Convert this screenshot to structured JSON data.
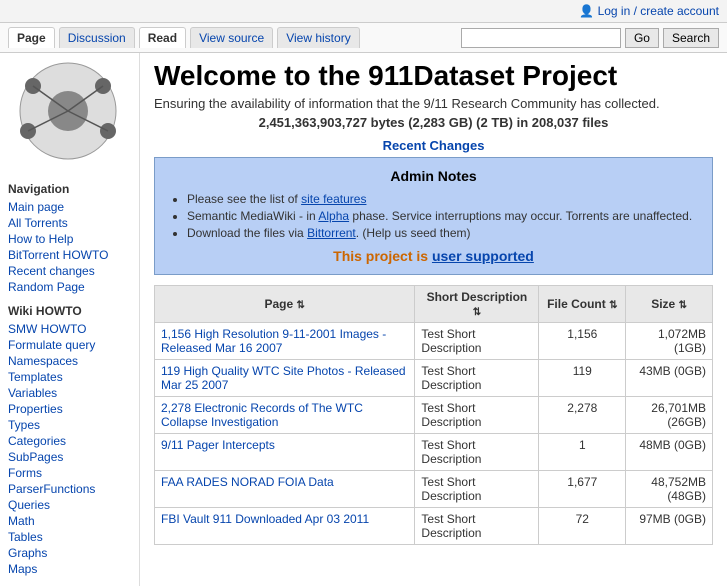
{
  "topbar": {
    "login_label": "Log in / create account",
    "icon": "👤"
  },
  "tabs": {
    "page": "Page",
    "discussion": "Discussion",
    "read": "Read",
    "view_source": "View source",
    "view_history": "View history",
    "search_placeholder": "",
    "go_label": "Go",
    "search_label": "Search"
  },
  "sidebar": {
    "nav_title": "Navigation",
    "nav_links": [
      {
        "label": "Main page",
        "href": "#"
      },
      {
        "label": "All Torrents",
        "href": "#"
      },
      {
        "label": "How to Help",
        "href": "#"
      },
      {
        "label": "BitTorrent HOWTO",
        "href": "#"
      },
      {
        "label": "Recent changes",
        "href": "#"
      },
      {
        "label": "Random Page",
        "href": "#"
      }
    ],
    "wiki_title": "Wiki HOWTO",
    "wiki_links": [
      {
        "label": "SMW HOWTO",
        "href": "#"
      },
      {
        "label": "Formulate query",
        "href": "#"
      },
      {
        "label": "Namespaces",
        "href": "#"
      },
      {
        "label": "Templates",
        "href": "#"
      },
      {
        "label": "Variables",
        "href": "#"
      },
      {
        "label": "Properties",
        "href": "#"
      },
      {
        "label": "Types",
        "href": "#"
      },
      {
        "label": "Categories",
        "href": "#"
      },
      {
        "label": "SubPages",
        "href": "#"
      },
      {
        "label": "Forms",
        "href": "#"
      },
      {
        "label": "ParserFunctions",
        "href": "#"
      },
      {
        "label": "Queries",
        "href": "#"
      },
      {
        "label": "Math",
        "href": "#"
      },
      {
        "label": "Tables",
        "href": "#"
      },
      {
        "label": "Graphs",
        "href": "#"
      },
      {
        "label": "Maps",
        "href": "#"
      }
    ]
  },
  "main": {
    "title": "Welcome to the 911Dataset Project",
    "subtitle": "Ensuring the availability of information that the 9/11 Research Community has collected.",
    "stats": "2,451,363,903,727 bytes (2,283 GB) (2 TB) in 208,037 files",
    "recent_changes": "Recent Changes",
    "admin_notes_title": "Admin Notes",
    "admin_notes": [
      {
        "text": "Please see the list of ",
        "link": "site features",
        "rest": ""
      },
      {
        "text": "Semantic MediaWiki - in ",
        "link": "Alpha",
        "rest": " phase. Service interruptions may occur. Torrents are unaffected."
      },
      {
        "text": "Download the files via ",
        "link": "Bittorrent",
        "rest": ". (Help us seed them)"
      }
    ],
    "supported_text": "This project is ",
    "supported_link": "user supported",
    "table": {
      "headers": [
        "Page",
        "Short Description",
        "File Count",
        "Size"
      ],
      "rows": [
        {
          "page": "1,156 High Resolution 9-11-2001 Images - Released Mar 16 2007",
          "desc": "Test Short Description",
          "count": "1,156",
          "size": "1,072MB (1GB)"
        },
        {
          "page": "119 High Quality WTC Site Photos - Released Mar 25 2007",
          "desc": "Test Short Description",
          "count": "119",
          "size": "43MB (0GB)"
        },
        {
          "page": "2,278 Electronic Records of The WTC Collapse Investigation",
          "desc": "Test Short Description",
          "count": "2,278",
          "size": "26,701MB (26GB)"
        },
        {
          "page": "9/11 Pager Intercepts",
          "desc": "Test Short Description",
          "count": "1",
          "size": "48MB (0GB)"
        },
        {
          "page": "FAA RADES NORAD FOIA Data",
          "desc": "Test Short Description",
          "count": "1,677",
          "size": "48,752MB (48GB)"
        },
        {
          "page": "FBI Vault 911 Downloaded Apr 03 2011",
          "desc": "Test Short Description",
          "count": "72",
          "size": "97MB (0GB)"
        }
      ]
    }
  }
}
